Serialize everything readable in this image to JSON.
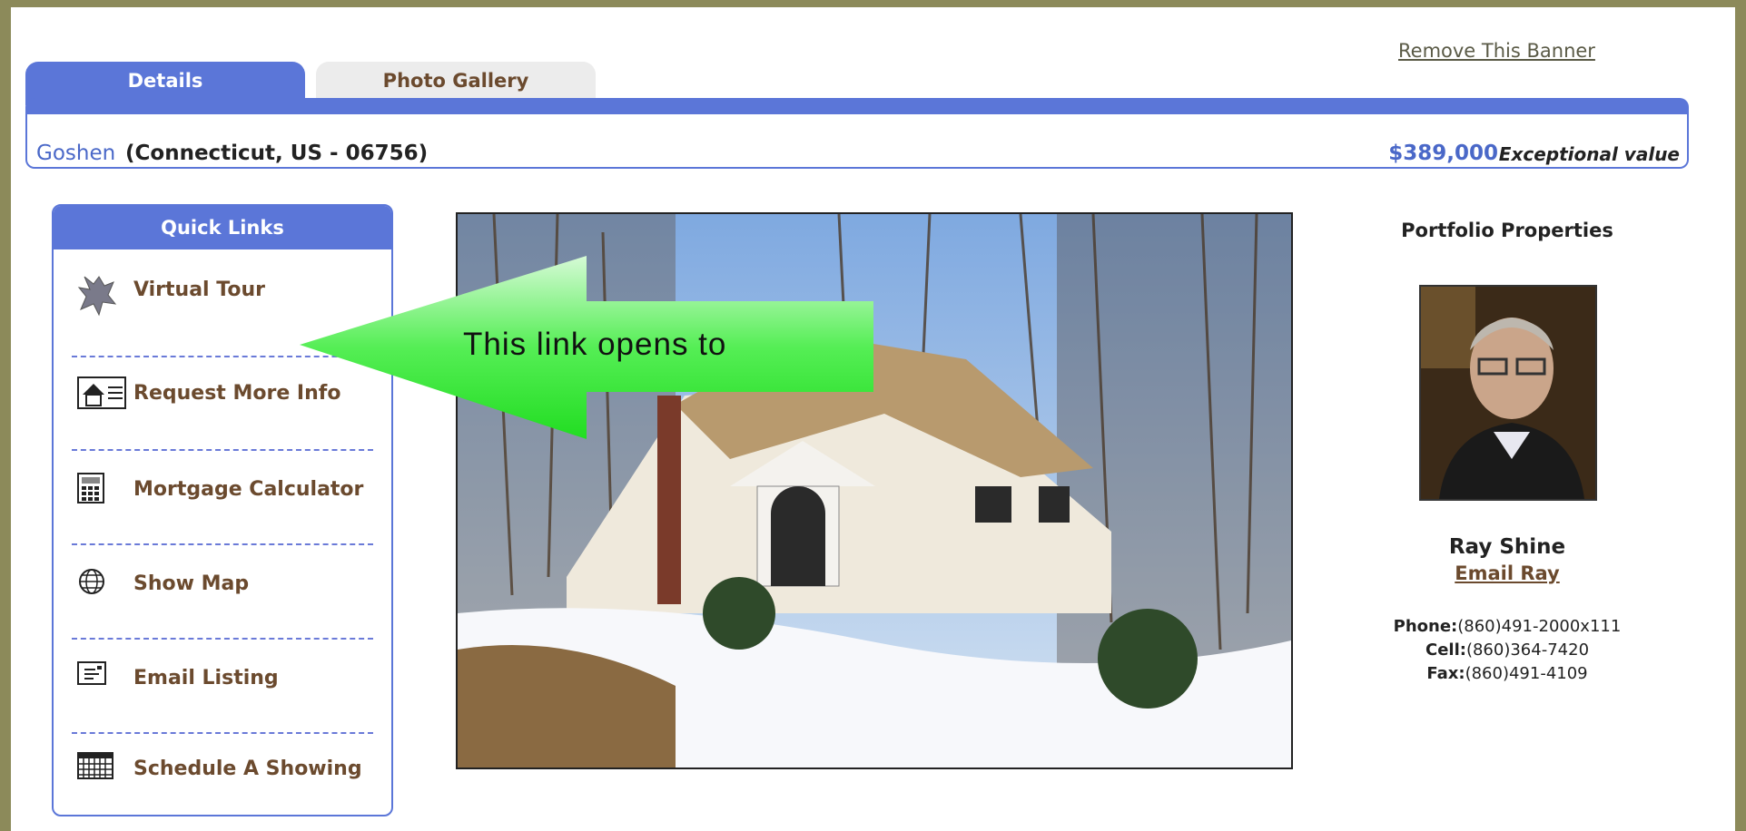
{
  "banner": {
    "remove_label": "Remove This Banner"
  },
  "tabs": [
    {
      "label": "Details",
      "active": true
    },
    {
      "label": "Photo Gallery",
      "active": false
    }
  ],
  "location": {
    "city": "Goshen",
    "region": "(Connecticut, US - 06756)",
    "price": "$389,000",
    "price_note": "Exceptional value"
  },
  "quick_links": {
    "title": "Quick Links",
    "items": [
      {
        "label": "Virtual Tour",
        "icon": "virtual-tour-icon"
      },
      {
        "label": "Request More Info",
        "icon": "house-info-icon"
      },
      {
        "label": "Mortgage Calculator",
        "icon": "calculator-icon"
      },
      {
        "label": "Show Map",
        "icon": "globe-icon"
      },
      {
        "label": "Email Listing",
        "icon": "email-icon"
      },
      {
        "label": "Schedule A Showing",
        "icon": "calendar-icon"
      }
    ]
  },
  "callout": {
    "text": "This link opens to"
  },
  "agent": {
    "section_title": "Portfolio Properties",
    "name": "Ray Shine",
    "email_label": "Email Ray",
    "phone_label": "Phone:",
    "phone": "(860)491-2000x111",
    "cell_label": "Cell:",
    "cell": "(860)364-7420",
    "fax_label": "Fax:",
    "fax": "(860)491-4109"
  },
  "colors": {
    "accent": "#5b76d8",
    "link_brown": "#6b4a2e",
    "background": "#8c8a5a",
    "callout_green": "#4ee84e"
  }
}
